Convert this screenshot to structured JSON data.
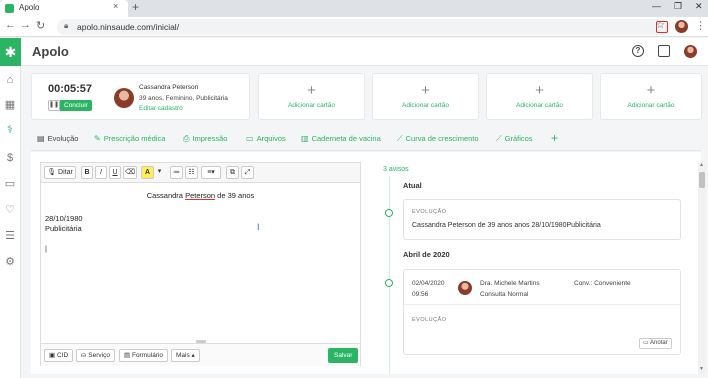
{
  "browser": {
    "tab_title": "Apolo",
    "url": "apolo.ninsaude.com/inicial/",
    "new_tab": "+",
    "tab_close": "×",
    "back": "←",
    "forward": "→",
    "reload": "↻",
    "star": "☆",
    "minimize": "—",
    "maximize": "❐",
    "close": "✕"
  },
  "app": {
    "name": "Apolo",
    "logo_glyph": "✱",
    "help_glyph": "?",
    "brand_color": "#2ab464"
  },
  "sidebar": {
    "items": [
      {
        "icon": "home-icon",
        "glyph": "⌂"
      },
      {
        "icon": "calendar-icon",
        "glyph": "▦"
      },
      {
        "icon": "stethoscope-icon",
        "glyph": "⚕"
      },
      {
        "icon": "money-icon",
        "glyph": "$"
      },
      {
        "icon": "bag-icon",
        "glyph": "▭"
      },
      {
        "icon": "heartbeat-icon",
        "glyph": "♡"
      },
      {
        "icon": "report-icon",
        "glyph": "☰"
      },
      {
        "icon": "settings-icon",
        "glyph": "⚙"
      }
    ]
  },
  "attendance": {
    "timer": "00:05:57",
    "pause_glyph": "❚❚",
    "finish_label": "Concluir",
    "patient_name": "Cassandra Peterson",
    "patient_info": "39 anos, Feminino, Publicitária",
    "edit_label": "Editar cadastro"
  },
  "add_cards": [
    {
      "plus": "+",
      "label": "Adicionar cartão"
    },
    {
      "plus": "+",
      "label": "Adicionar cartão"
    },
    {
      "plus": "+",
      "label": "Adicionar cartão"
    },
    {
      "plus": "+",
      "label": "Adicionar cartão"
    }
  ],
  "tabs": [
    {
      "label": "Evolução",
      "icon": "evolution-icon",
      "glyph": "▤"
    },
    {
      "label": "Prescrição médica",
      "icon": "pill-icon",
      "glyph": "✎"
    },
    {
      "label": "Impressão",
      "icon": "print-icon",
      "glyph": "⎙"
    },
    {
      "label": "Arquivos",
      "icon": "folder-icon",
      "glyph": "▭"
    },
    {
      "label": "Caderneta de vacina",
      "icon": "vaccine-icon",
      "glyph": "▥"
    },
    {
      "label": "Curva de crescimento",
      "icon": "growth-chart-icon",
      "glyph": "⟋"
    },
    {
      "label": "Gráficos",
      "icon": "chart-icon",
      "glyph": "⟋"
    }
  ],
  "tabs_add": "+",
  "editor": {
    "dictate_label": "Ditar",
    "toolbar": {
      "bold": "B",
      "italic": "I",
      "underline": "U",
      "eraser": "⌫",
      "color_a": "A",
      "dropdown": "▾",
      "ordered_list": "≔",
      "unordered_list": "☷",
      "align": "≡",
      "copy": "⧉",
      "fullscreen": "⤢"
    },
    "lines": {
      "title_before": "Cassandra ",
      "title_name": "Peterson",
      "title_after": " de 39 anos",
      "date": "28/10/1980",
      "profession": "Publicitária",
      "caret": "|"
    },
    "cursor_glyph": "I",
    "bottom": {
      "cid": "CID",
      "servico": "Serviço",
      "formulario": "Formulário",
      "mais": "Mais ▴",
      "salvar": "Salvar"
    }
  },
  "timeline": {
    "alerts": "3 avisos",
    "current_header": "Atual",
    "current_tag": "EVOLUÇÃO",
    "current_text": "Cassandra Peterson de 39 anos anos  28/10/1980Publicitária",
    "month_header": "Abril de 2020",
    "entry": {
      "date": "02/04/2020",
      "time": "09:56",
      "doctor": "Dra. Michele Martins",
      "consult": "Consulta Normal",
      "insurance": "Conv.: Conveniente",
      "tag": "EVOLUÇÃO",
      "annotate": "Anotar"
    }
  }
}
